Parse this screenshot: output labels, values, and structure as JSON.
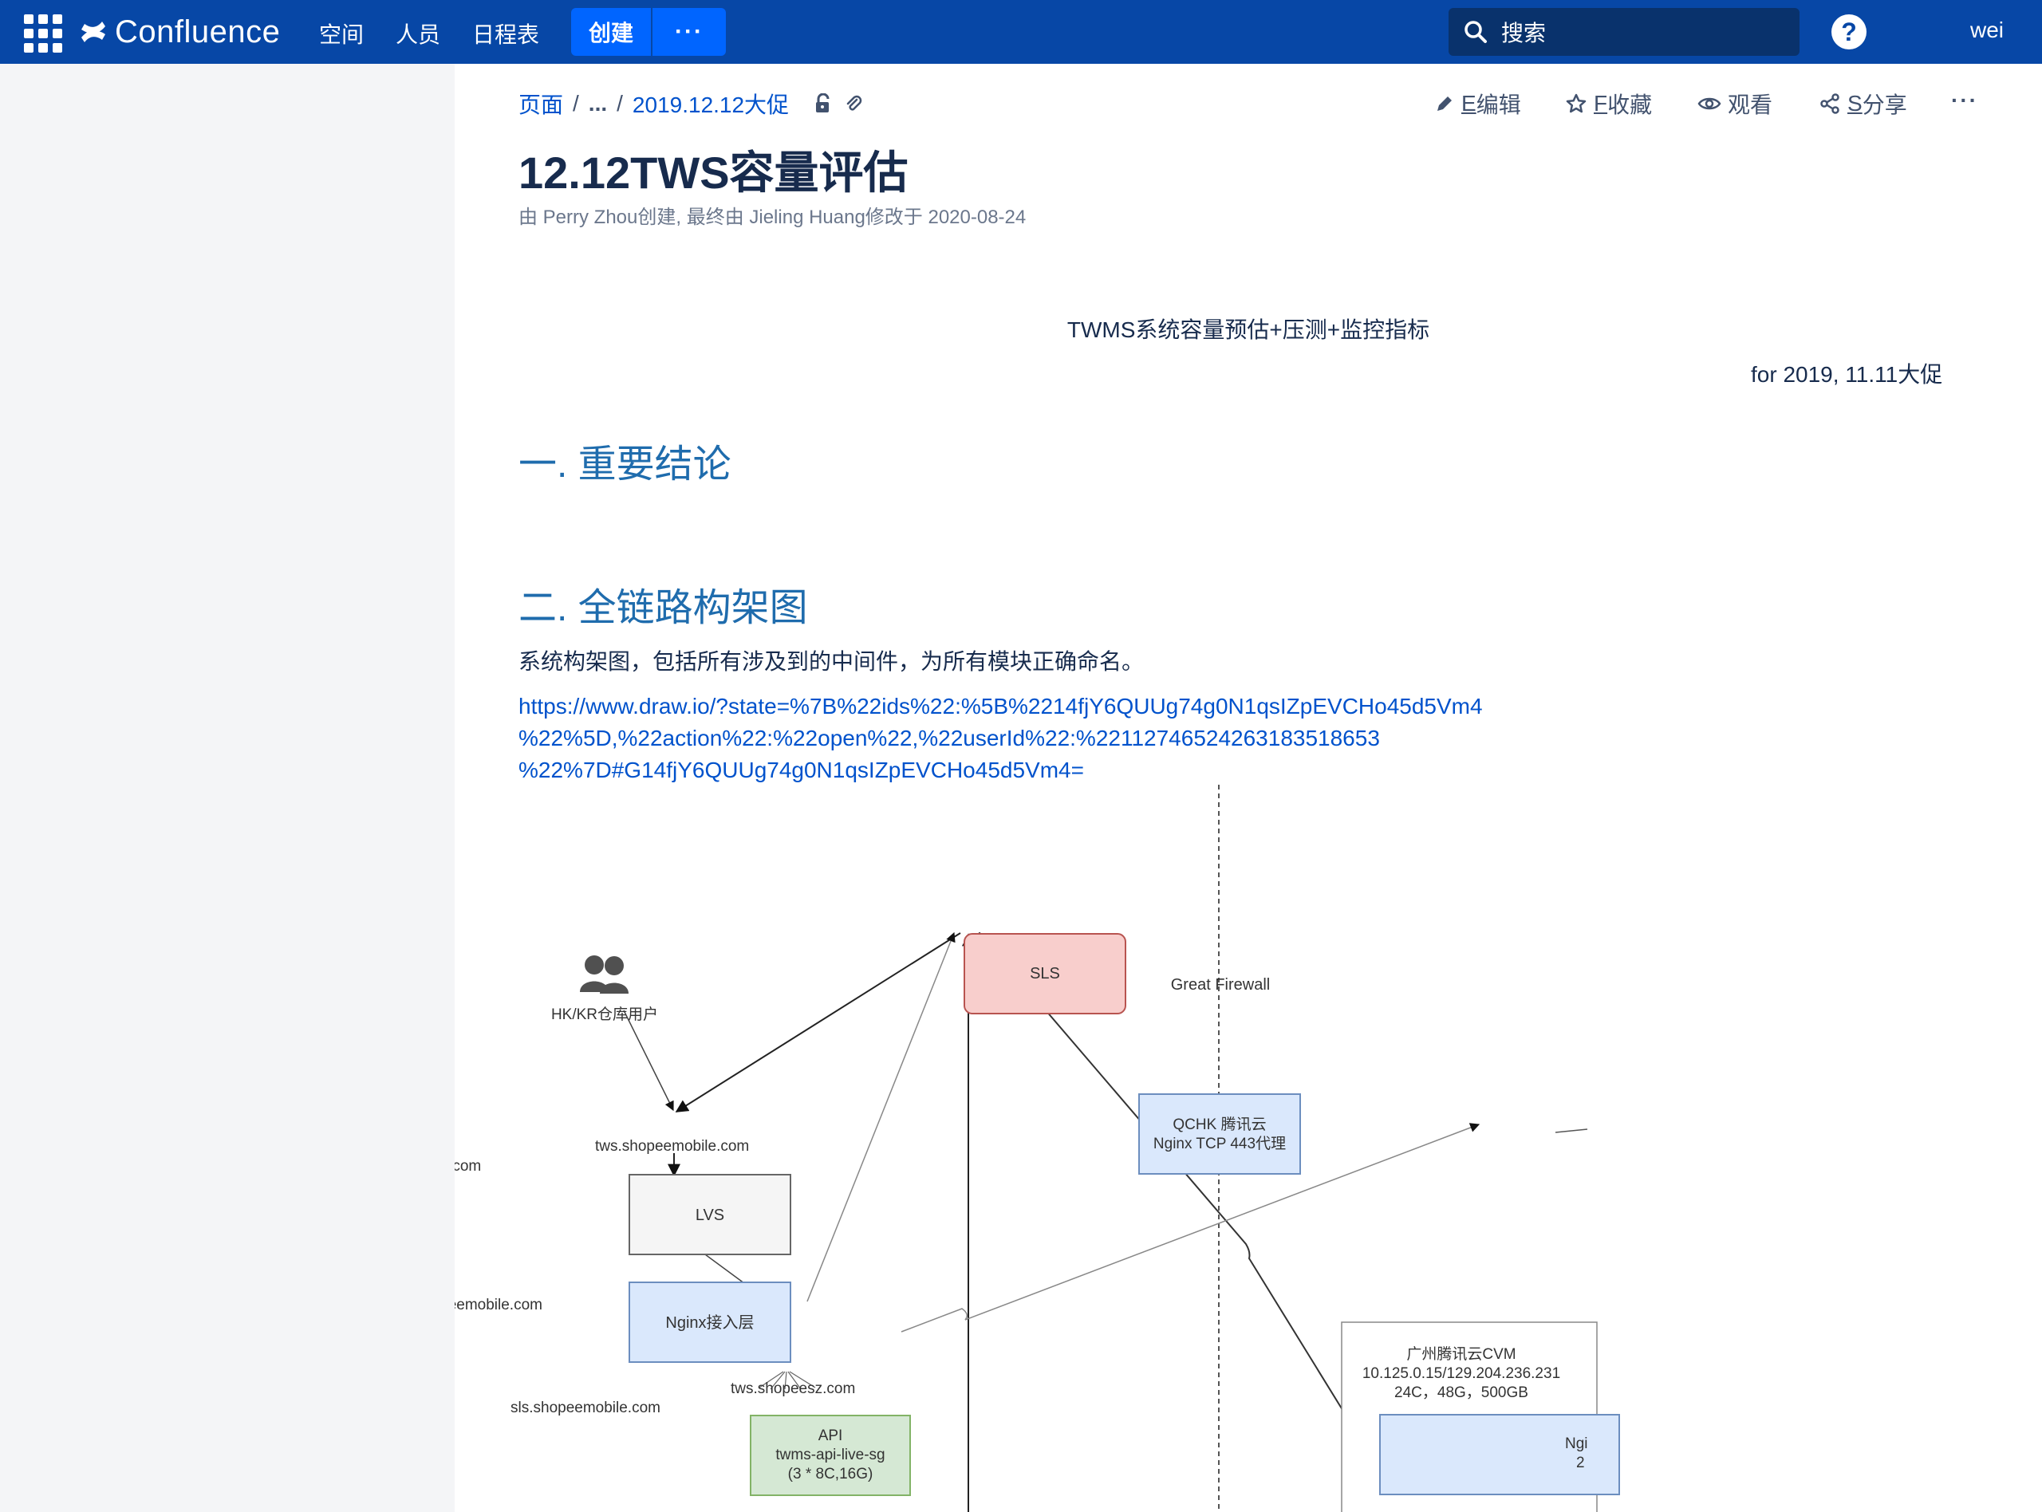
{
  "nav": {
    "brand": "Confluence",
    "links": [
      "空间",
      "人员",
      "日程表"
    ],
    "create_label": "创建",
    "more_label": "···",
    "search_placeholder": "搜索",
    "help": "?",
    "user": "wei"
  },
  "page": {
    "breadcrumb": {
      "root": "页面",
      "ellipsis": "...",
      "parent": "2019.12.12大促"
    },
    "actions": {
      "edit_key": "E",
      "edit": "编辑",
      "fav_key": "F",
      "fav": "收藏",
      "watch": "观看",
      "share_key": "S",
      "share": "分享",
      "more": "···"
    },
    "title": "12.12TWS容量评估",
    "byline": "由 Perry Zhou创建, 最终由 Jieling Huang修改于 2020-08-24",
    "center_title": "TWMS系统容量预估+压测+监控指标",
    "for_line": "for  2019, 11.11大促",
    "h2_1": "一.   重要结论",
    "h2_2": "二.   全链路构架图",
    "para": "系统构架图，包括所有涉及到的中间件，为所有模块正确命名。",
    "link_lines": [
      "https://www.draw.io/?state=%7B%22ids%22:%5B%2214fjY6QUUg74g0N1qsIZpEVCHo45d5Vm4",
      "%22%5D,%22action%22:%22open%22,%22userId%22:%22112746524263183518653",
      "%22%7D#G14fjY6QUUg74g0N1qsIZpEVCHo45d5Vm4="
    ]
  },
  "diagram": {
    "users_label": "HK/KR仓库用户",
    "sls": "SLS",
    "lvs": "LVS",
    "nginx": "Nginx接入层",
    "api": [
      "API",
      "twms-api-live-sg",
      "(3 * 8C,16G)"
    ],
    "great_firewall": "Great Firewall",
    "qchk": [
      "QCHK 腾讯云",
      "Nginx TCP 443代理"
    ],
    "cvm": [
      "广州腾讯云CVM",
      "10.125.0.15/129.204.236.231",
      "24C，48G，500GB"
    ],
    "cvm_inner": [
      "Ngi",
      "2"
    ],
    "edge_labels": {
      "users_lvs": "tws.shopeemobile.com",
      "sls_lvs": "tws.shopeemobile.com",
      "api_sls": "sls.shopeemobile.com",
      "vertical_sls": "sls.shopeemobile.com",
      "api_qchk": "tws.shopeesz.com"
    },
    "colors": {
      "sls_fill": "#f8cecc",
      "sls_stroke": "#b85450",
      "lvs_fill": "#f5f5f5",
      "lvs_stroke": "#666666",
      "blue_fill": "#dae8fc",
      "blue_stroke": "#6c8ebf",
      "green_fill": "#d5e8d4",
      "green_stroke": "#82b366"
    }
  }
}
